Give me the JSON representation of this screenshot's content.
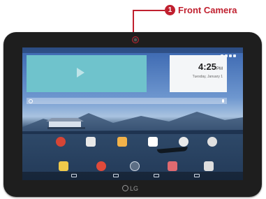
{
  "callout": {
    "number": "1",
    "label": "Front Camera"
  },
  "device": {
    "brand": "LG"
  },
  "screen": {
    "clock": {
      "time": "4:25",
      "ampm": "PM",
      "date": "Tuesday, January 1"
    },
    "colors": {
      "callout": "#c0202f",
      "bezel": "#1e1e1e",
      "music_widget": "#6fc3cc",
      "clock_widget": "#f4f6f8"
    },
    "dock_icons": [
      {
        "name": "google-icon",
        "color": "#d64535"
      },
      {
        "name": "qpair-icon",
        "color": "#e8e8e8"
      },
      {
        "name": "dual-window-icon",
        "color": "#f2b24a"
      },
      {
        "name": "play-store-icon",
        "color": "#ffffff"
      },
      {
        "name": "contacts-icon",
        "color": "#e9e9e9"
      },
      {
        "name": "maps-icon",
        "color": "#e0e0e0"
      }
    ],
    "hotseat_icons": [
      {
        "name": "memo-icon",
        "color": "#f0c94a"
      },
      {
        "name": "chrome-icon",
        "color": "#e04a3a"
      },
      {
        "name": "apps-icon",
        "color": "#cfd8e4"
      },
      {
        "name": "gallery-icon",
        "color": "#e06a70"
      },
      {
        "name": "camera-icon",
        "color": "#dedede"
      }
    ]
  }
}
